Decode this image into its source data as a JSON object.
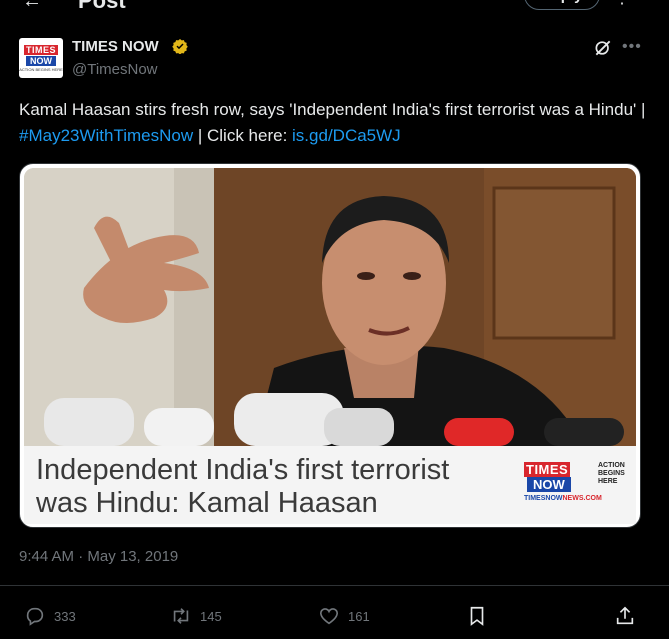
{
  "topbar": {
    "back": "←",
    "title": "Post",
    "reply_label": "Reply",
    "more": "⋮"
  },
  "author": {
    "name": "TIMES NOW",
    "handle": "@TimesNow",
    "avatar_line1": "TIMES",
    "avatar_line2": "NOW",
    "avatar_line3": "ACTION BEGINS HERE",
    "verified_color": "#e2b719"
  },
  "tweet": {
    "text_part1": "Kamal Haasan stirs fresh row, says 'Independent India's first terrorist was a Hindu'  | ",
    "hashtag": "#May23WithTimesNow",
    "text_part2": " | Click here: ",
    "link": "is.gd/DCa5WJ"
  },
  "media": {
    "caption_line1": "Independent India's first terrorist",
    "caption_line2": "was Hindu: Kamal Haasan",
    "logo_line1": "TIMES",
    "logo_line2": "NOW",
    "logo_tagline": "ACTION BEGINS HERE",
    "logo_site_a": "TIMESNOW",
    "logo_site_b": "NEWS.COM"
  },
  "meta": {
    "timestamp": "9:44 AM · May 13, 2019"
  },
  "actions": {
    "replies": "333",
    "reposts": "145",
    "likes": "161"
  },
  "colors": {
    "accent": "#1d9bf0",
    "muted": "#71767b",
    "background": "#000000",
    "brand_red": "#d8262e",
    "brand_blue": "#1a47a8"
  },
  "icons": [
    "back-arrow-icon",
    "verified-badge-icon",
    "grok-icon",
    "more-icon",
    "reply-icon",
    "repost-icon",
    "like-icon",
    "bookmark-icon",
    "share-icon"
  ]
}
